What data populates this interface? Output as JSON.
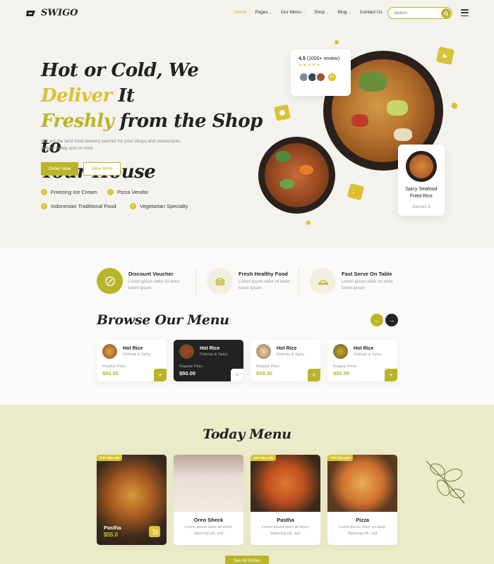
{
  "brand": {
    "name": "SWIGO",
    "accent": "#b9b52b",
    "accent_light": "#d9c233",
    "dark": "#222222"
  },
  "nav": {
    "items": [
      {
        "label": "Home",
        "active": true,
        "caret": false
      },
      {
        "label": "Pages",
        "caret": true
      },
      {
        "label": "Our Menu",
        "caret": true
      },
      {
        "label": "Shop",
        "caret": true
      },
      {
        "label": "Blog",
        "caret": true
      },
      {
        "label": "Contact Us",
        "caret": false
      }
    ],
    "search_placeholder": "Search",
    "search_icon": "search-icon",
    "menu_icon": "hamburger-icon"
  },
  "hero": {
    "title_1a": "Hot or Cold, We ",
    "title_1b": "Deliver",
    "title_1c": " It",
    "title_2a": "Freshly",
    "title_2b": " from the Shop to",
    "title_3": "Your House",
    "description": "We are the best food delivery partner for your shops and restaurants, deliver safely and on time",
    "order_btn": "Order Now",
    "view_btn": "View More",
    "features": [
      "Freezing Ice Cream",
      "Pizza Vendor",
      "Indonesian Traditional Food",
      "Vegetarian Specialty"
    ],
    "review": {
      "rating": "4.5",
      "count": "(1000+ review)",
      "stars": "★★★★★",
      "more": "5+"
    },
    "dish_card": {
      "name_1": "Spicy Seafood",
      "name_2": "Fried Rice",
      "serves": "Serves 4"
    }
  },
  "services": [
    {
      "title": "Discount Voucher",
      "desc": "Lorem ipsum dolor sit amet lorem ipsum",
      "icon": "voucher-icon"
    },
    {
      "title": "Fresh Healthy Food",
      "desc": "Lorem ipsum dolor sit amet lorem ipsum",
      "icon": "burger-icon"
    },
    {
      "title": "Fast Serve On Table",
      "desc": "Lorem ipsum dolor sit amet lorem ipsum",
      "icon": "serve-icon"
    }
  ],
  "browse": {
    "title": "Browse Our Menu",
    "cards": [
      {
        "name": "Hot Rice",
        "sub": "Delicias & Spicy",
        "price_label": "Regular Price",
        "price": "$50.00",
        "dark": false
      },
      {
        "name": "Hot Rice",
        "sub": "Delicias & Spicy",
        "price_label": "Regular Price",
        "price": "$50.00",
        "dark": true
      },
      {
        "name": "Hot Rice",
        "sub": "Delicias & Spicy",
        "price_label": "Regular Price",
        "price": "$50.00",
        "dark": false
      },
      {
        "name": "Hot Rice",
        "sub": "Delicias & Spicy",
        "price_label": "Regular Price",
        "price": "$50.00",
        "dark": false
      }
    ],
    "add_symbol": "+"
  },
  "today": {
    "title": "Today Menu",
    "badge": "TOP SELLER",
    "cards": [
      {
        "name": "Pastha",
        "price": "$55.0",
        "desc": "",
        "featured": true
      },
      {
        "name": "Oreo Sheck",
        "desc": "Lorem ipsum dolor sit amet, dipiscing elit, sed",
        "featured": false
      },
      {
        "name": "Pastha",
        "desc": "Lorem ipsum dolor sit amet, dipiscing elit, sed",
        "featured": false
      },
      {
        "name": "Pizza",
        "desc": "Lorem ipsum dolor sit amet, dipiscing elit, sed",
        "featured": false
      }
    ],
    "see_all": "See All Dishes"
  }
}
